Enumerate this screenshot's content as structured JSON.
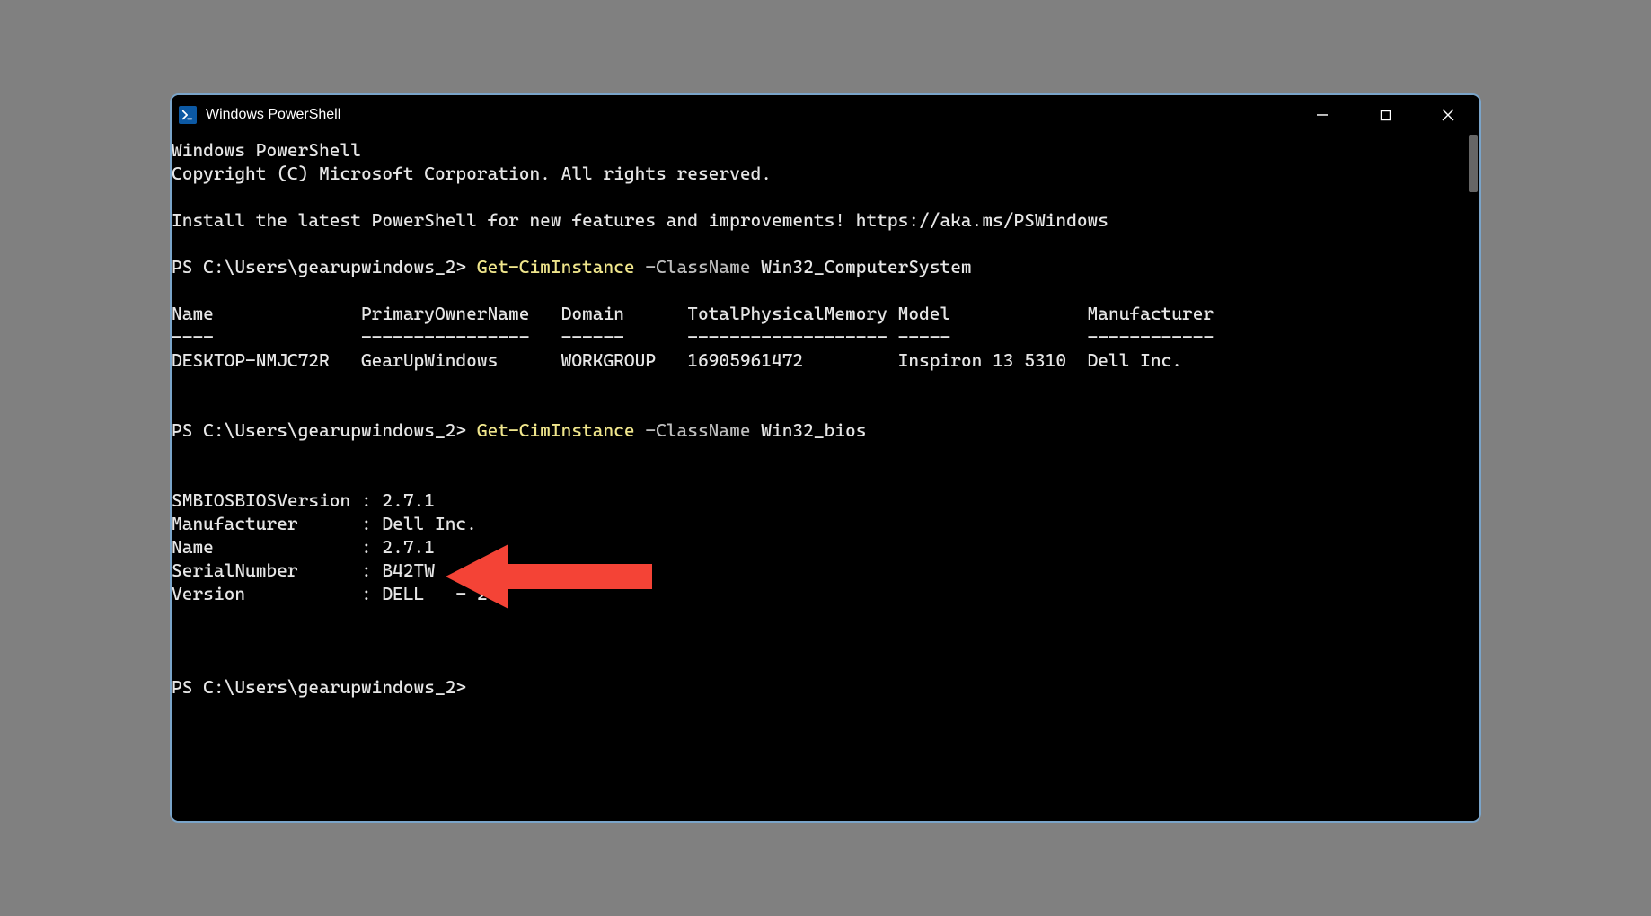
{
  "window": {
    "title": "Windows PowerShell"
  },
  "banner": {
    "line1": "Windows PowerShell",
    "line2": "Copyright (C) Microsoft Corporation. All rights reserved.",
    "blank1": "",
    "install": "Install the latest PowerShell for new features and improvements! https://aka.ms/PSWindows",
    "blank2": ""
  },
  "cmd1": {
    "prompt": "PS C:\\Users\\gearupwindows_2> ",
    "cmdlet": "Get-CimInstance",
    "param": " -ClassName",
    "arg": " Win32_ComputerSystem"
  },
  "table1": {
    "blank_before": "",
    "header": "Name              PrimaryOwnerName   Domain      TotalPhysicalMemory Model             Manufacturer",
    "divider": "----              ----------------   ------      ------------------- -----             ------------",
    "row": "DESKTOP-NMJC72R   GearUpWindows      WORKGROUP   16905961472         Inspiron 13 5310  Dell Inc.",
    "blank_after1": "",
    "blank_after2": ""
  },
  "cmd2": {
    "prompt": "PS C:\\Users\\gearupwindows_2> ",
    "cmdlet": "Get-CimInstance",
    "param": " -ClassName",
    "arg": " Win32_bios"
  },
  "bios": {
    "blank_before1": "",
    "blank_before2": "",
    "l1": "SMBIOSBIOSVersion : 2.7.1",
    "l2": "Manufacturer      : Dell Inc.",
    "l3": "Name              : 2.7.1",
    "l4": "SerialNumber      : B42TW",
    "l5": "Version           : DELL   - 2",
    "blank_after1": "",
    "blank_after2": "",
    "blank_after3": ""
  },
  "prompt3": {
    "text": "PS C:\\Users\\gearupwindows_2>"
  }
}
